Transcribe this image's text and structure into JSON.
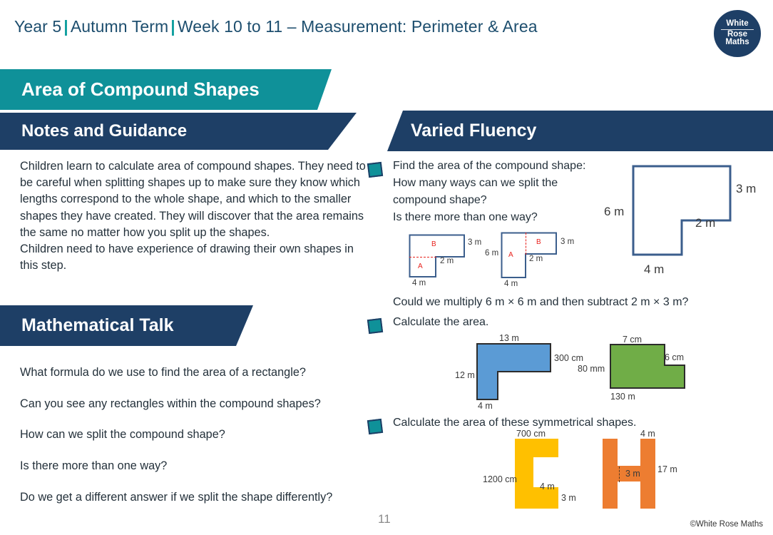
{
  "header": {
    "year": "Year 5",
    "term": "Autumn Term",
    "week": "Week 10 to 11 – Measurement: Perimeter & Area",
    "separator": "|",
    "logo": {
      "line1": "White",
      "line2": "Rose",
      "line3": "Maths"
    }
  },
  "left": {
    "topic_banner": "Area of Compound Shapes",
    "notes_banner": "Notes and Guidance",
    "notes_body": "Children learn to calculate area of compound shapes. They need to be careful when splitting shapes up to make sure they know which lengths correspond to the whole shape, and which to the smaller shapes they have created.  They will discover that the area remains the same no matter how you split up the shapes.\nChildren need to have experience of drawing their own shapes in this step.",
    "talk_banner": "Mathematical Talk",
    "talk_questions": [
      "What formula do we use to find the area of a rectangle?",
      "Can you see any rectangles within the compound shapes?",
      "How can we split the compound shape?",
      "Is there more than one way?",
      "Do we get a different answer if we split the shape differently?"
    ]
  },
  "right": {
    "banner": "Varied Fluency",
    "q1": {
      "text": "Find the area of the compound shape:\nHow many ways can we split the compound shape?\nIs there more than one way?",
      "followup": "Could we multiply 6 m × 6 m and then subtract 2 m × 3 m?",
      "main_shape": {
        "labels": {
          "left": "6 m",
          "right": "3 m",
          "inner": "2 m",
          "bottom": "4 m"
        }
      },
      "split_a": {
        "labels": {
          "right": "3 m",
          "inner": "2 m",
          "bottom": "4 m"
        },
        "part_top": "B",
        "part_bottom": "A"
      },
      "split_b": {
        "labels": {
          "left": "6 m",
          "right": "3 m",
          "inner": "2 m",
          "bottom": "4 m"
        },
        "part_left": "A",
        "part_right": "B"
      }
    },
    "q2": {
      "text": "Calculate the area.",
      "blue_shape": {
        "color": "#5b9bd5",
        "labels": {
          "top": "13 m",
          "right": "300 cm",
          "left": "12 m",
          "bottom": "4 m"
        }
      },
      "green_shape": {
        "color": "#70ad47",
        "labels": {
          "top": "7 cm",
          "right": "6 cm",
          "left": "80 mm",
          "bottom": "130 m"
        }
      }
    },
    "q3": {
      "text": "Calculate the area of these symmetrical shapes.",
      "yellow_shape": {
        "color": "#ffc000",
        "labels": {
          "top": "700 cm",
          "left": "1200 cm",
          "inner": "4 m",
          "bottom_right": "3 m"
        }
      },
      "orange_shape": {
        "color": "#ed7d31",
        "labels": {
          "top": "4 m",
          "middle": "3 m",
          "right": "17 m"
        }
      }
    }
  },
  "footer": {
    "page": "11",
    "copyright": "©White Rose Maths"
  },
  "colors": {
    "teal": "#0f9199",
    "navy": "#1e3f66",
    "title": "#1f4a6b",
    "red": "#e8231e"
  }
}
